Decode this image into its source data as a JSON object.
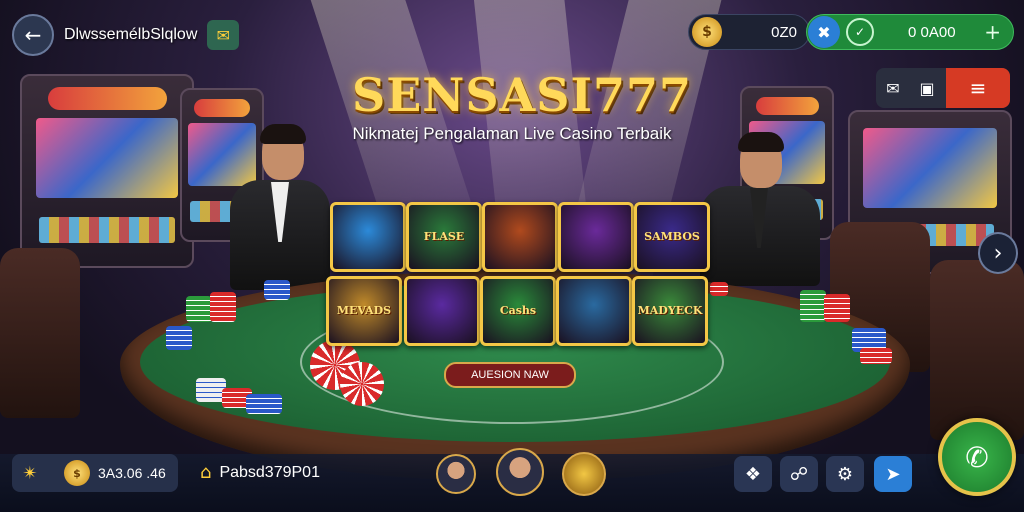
{
  "header": {
    "back_icon": "back-arrow-icon",
    "title": "DlwssemélbSlqlow",
    "badge_icon": "gift-icon"
  },
  "wallet": {
    "coins": "0Z0",
    "cash": "0 0A00",
    "plus_label": "+"
  },
  "menu": {
    "icons": [
      "mail-icon",
      "camera-icon",
      "hamburger-icon"
    ]
  },
  "logo": {
    "title": "SENSASI777",
    "subtitle": "Nikmatej Pengalaman Live Casino Terbaik"
  },
  "games": [
    {
      "label": "",
      "color": "#2c8ad9"
    },
    {
      "label": "FLASE",
      "color": "#2a7a3a"
    },
    {
      "label": "",
      "color": "#b04a1e"
    },
    {
      "label": "",
      "color": "#6a2a9a"
    },
    {
      "label": "SAMBOS",
      "color": "#3a2a8a"
    },
    {
      "label": "MEVADS",
      "color": "#c08a2a"
    },
    {
      "label": "",
      "color": "#5a2aa0"
    },
    {
      "label": "Cashs",
      "color": "#2a8a3a"
    },
    {
      "label": "",
      "color": "#2a6aa0"
    },
    {
      "label": "MADYECK",
      "color": "#3a8a3a"
    }
  ],
  "promo_label": "AUESION NAW",
  "bottom": {
    "balance": "3A3.06 .46",
    "username": "Pabsd379P01"
  },
  "colors": {
    "accent_gold": "#f4c746",
    "cash_green": "#1f8a3a",
    "menu_red": "#d63a24"
  }
}
